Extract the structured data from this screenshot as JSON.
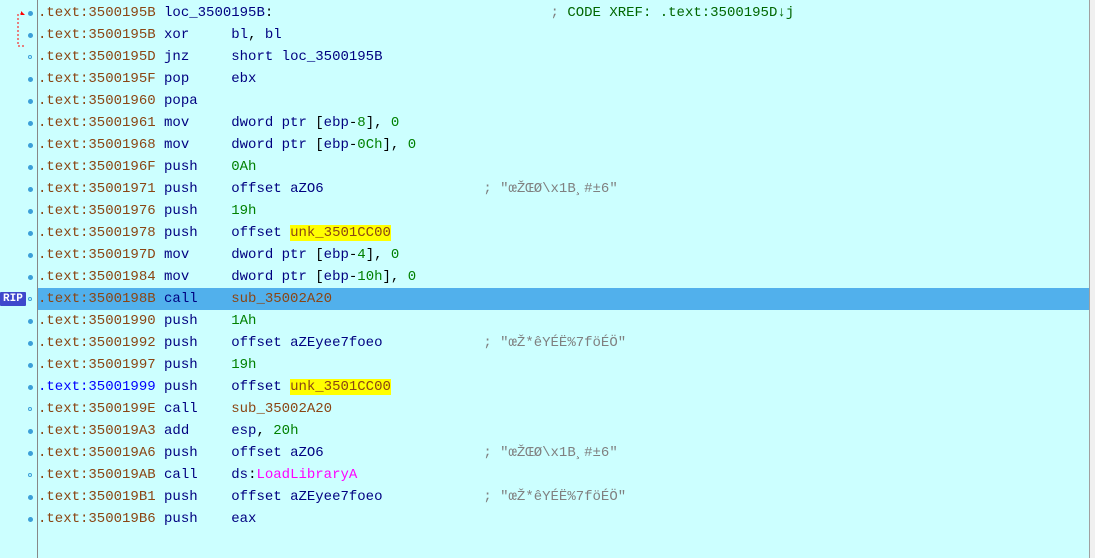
{
  "rip_label": "RIP",
  "lines": [
    {
      "addr_color": "brown",
      "addr": ".text:3500195B",
      "parts": [
        {
          "t": " ",
          "c": ""
        },
        {
          "t": "loc_3500195B",
          "c": "label"
        },
        {
          "t": ":",
          "c": ""
        },
        {
          "t": "                                 ",
          "c": ""
        },
        {
          "t": "; ",
          "c": "comment"
        },
        {
          "t": "CODE XREF: .text:3500195D↓j",
          "c": "xref-dark"
        }
      ],
      "dot": "solid"
    },
    {
      "addr_color": "brown",
      "addr": ".text:3500195B",
      "parts": [
        {
          "t": " ",
          "c": ""
        },
        {
          "t": "xor     ",
          "c": "mnemonic"
        },
        {
          "t": "bl",
          "c": "reg"
        },
        {
          "t": ", ",
          "c": ""
        },
        {
          "t": "bl",
          "c": "reg"
        }
      ],
      "dot": "solid"
    },
    {
      "addr_color": "brown",
      "addr": ".text:3500195D",
      "parts": [
        {
          "t": " ",
          "c": ""
        },
        {
          "t": "jnz     ",
          "c": "mnemonic"
        },
        {
          "t": "short ",
          "c": "keyword"
        },
        {
          "t": "loc_3500195B",
          "c": "operand"
        }
      ],
      "dot": "hollow"
    },
    {
      "addr_color": "brown",
      "addr": ".text:3500195F",
      "parts": [
        {
          "t": " ",
          "c": ""
        },
        {
          "t": "pop     ",
          "c": "mnemonic"
        },
        {
          "t": "ebx",
          "c": "reg"
        }
      ],
      "dot": "solid"
    },
    {
      "addr_color": "brown",
      "addr": ".text:35001960",
      "parts": [
        {
          "t": " ",
          "c": ""
        },
        {
          "t": "popa",
          "c": "mnemonic"
        }
      ],
      "dot": "solid"
    },
    {
      "addr_color": "brown",
      "addr": ".text:35001961",
      "parts": [
        {
          "t": " ",
          "c": ""
        },
        {
          "t": "mov     ",
          "c": "mnemonic"
        },
        {
          "t": "dword ptr ",
          "c": "keyword"
        },
        {
          "t": "[",
          "c": ""
        },
        {
          "t": "ebp",
          "c": "reg"
        },
        {
          "t": "-",
          "c": ""
        },
        {
          "t": "8",
          "c": "num-green"
        },
        {
          "t": "], ",
          "c": ""
        },
        {
          "t": "0",
          "c": "num-green"
        }
      ],
      "dot": "solid"
    },
    {
      "addr_color": "brown",
      "addr": ".text:35001968",
      "parts": [
        {
          "t": " ",
          "c": ""
        },
        {
          "t": "mov     ",
          "c": "mnemonic"
        },
        {
          "t": "dword ptr ",
          "c": "keyword"
        },
        {
          "t": "[",
          "c": ""
        },
        {
          "t": "ebp",
          "c": "reg"
        },
        {
          "t": "-",
          "c": ""
        },
        {
          "t": "0Ch",
          "c": "num-green"
        },
        {
          "t": "], ",
          "c": ""
        },
        {
          "t": "0",
          "c": "num-green"
        }
      ],
      "dot": "solid"
    },
    {
      "addr_color": "brown",
      "addr": ".text:3500196F",
      "parts": [
        {
          "t": " ",
          "c": ""
        },
        {
          "t": "push    ",
          "c": "mnemonic"
        },
        {
          "t": "0Ah",
          "c": "num-green"
        }
      ],
      "dot": "solid"
    },
    {
      "addr_color": "brown",
      "addr": ".text:35001971",
      "parts": [
        {
          "t": " ",
          "c": ""
        },
        {
          "t": "push    ",
          "c": "mnemonic"
        },
        {
          "t": "offset ",
          "c": "keyword"
        },
        {
          "t": "aZO6",
          "c": "operand"
        },
        {
          "t": "                   ",
          "c": ""
        },
        {
          "t": "; \"œŽŒØ\\x1B¸#±6\"",
          "c": "comment"
        }
      ],
      "dot": "solid"
    },
    {
      "addr_color": "brown",
      "addr": ".text:35001976",
      "parts": [
        {
          "t": " ",
          "c": ""
        },
        {
          "t": "push    ",
          "c": "mnemonic"
        },
        {
          "t": "19h",
          "c": "num-green"
        }
      ],
      "dot": "solid"
    },
    {
      "addr_color": "brown",
      "addr": ".text:35001978",
      "parts": [
        {
          "t": " ",
          "c": ""
        },
        {
          "t": "push    ",
          "c": "mnemonic"
        },
        {
          "t": "offset ",
          "c": "keyword"
        },
        {
          "t": "unk_3501CC00",
          "c": "hl-yellow"
        }
      ],
      "dot": "solid"
    },
    {
      "addr_color": "brown",
      "addr": ".text:3500197D",
      "parts": [
        {
          "t": " ",
          "c": ""
        },
        {
          "t": "mov     ",
          "c": "mnemonic"
        },
        {
          "t": "dword ptr ",
          "c": "keyword"
        },
        {
          "t": "[",
          "c": ""
        },
        {
          "t": "ebp",
          "c": "reg"
        },
        {
          "t": "-",
          "c": ""
        },
        {
          "t": "4",
          "c": "num-green"
        },
        {
          "t": "], ",
          "c": ""
        },
        {
          "t": "0",
          "c": "num-green"
        }
      ],
      "dot": "solid"
    },
    {
      "addr_color": "brown",
      "addr": ".text:35001984",
      "parts": [
        {
          "t": " ",
          "c": ""
        },
        {
          "t": "mov     ",
          "c": "mnemonic"
        },
        {
          "t": "dword ptr ",
          "c": "keyword"
        },
        {
          "t": "[",
          "c": ""
        },
        {
          "t": "ebp",
          "c": "reg"
        },
        {
          "t": "-",
          "c": ""
        },
        {
          "t": "10h",
          "c": "num-green"
        },
        {
          "t": "], ",
          "c": ""
        },
        {
          "t": "0",
          "c": "num-green"
        }
      ],
      "dot": "solid"
    },
    {
      "addr_color": "brown",
      "addr": ".text:3500198B",
      "parts": [
        {
          "t": " ",
          "c": ""
        },
        {
          "t": "call    ",
          "c": "mnemonic"
        },
        {
          "t": "sub_35002A20",
          "c": "sub-name"
        }
      ],
      "selected": true,
      "dot": "hollow",
      "rip": true
    },
    {
      "addr_color": "brown",
      "addr": ".text:35001990",
      "parts": [
        {
          "t": " ",
          "c": ""
        },
        {
          "t": "push    ",
          "c": "mnemonic"
        },
        {
          "t": "1Ah",
          "c": "num-green"
        }
      ],
      "dot": "solid"
    },
    {
      "addr_color": "brown",
      "addr": ".text:35001992",
      "parts": [
        {
          "t": " ",
          "c": ""
        },
        {
          "t": "push    ",
          "c": "mnemonic"
        },
        {
          "t": "offset ",
          "c": "keyword"
        },
        {
          "t": "aZEyee7foeo",
          "c": "operand"
        },
        {
          "t": "            ",
          "c": ""
        },
        {
          "t": "; \"œŽ*êYÉË%7föÉÖ\"",
          "c": "comment"
        }
      ],
      "dot": "solid"
    },
    {
      "addr_color": "brown",
      "addr": ".text:35001997",
      "parts": [
        {
          "t": " ",
          "c": ""
        },
        {
          "t": "push    ",
          "c": "mnemonic"
        },
        {
          "t": "19h",
          "c": "num-green"
        }
      ],
      "dot": "solid"
    },
    {
      "addr_color": "blue",
      "addr": ".text:35001999",
      "parts": [
        {
          "t": " ",
          "c": ""
        },
        {
          "t": "push    ",
          "c": "mnemonic"
        },
        {
          "t": "offset ",
          "c": "keyword"
        },
        {
          "t": "unk_3501CC",
          "c": "hl-yellow"
        },
        {
          "t": "00",
          "c": "hl-yellow"
        }
      ],
      "dot": "solid"
    },
    {
      "addr_color": "brown",
      "addr": ".text:3500199E",
      "parts": [
        {
          "t": " ",
          "c": ""
        },
        {
          "t": "call    ",
          "c": "mnemonic"
        },
        {
          "t": "sub_35002A20",
          "c": "sub-name"
        }
      ],
      "dot": "hollow"
    },
    {
      "addr_color": "brown",
      "addr": ".text:350019A3",
      "parts": [
        {
          "t": " ",
          "c": ""
        },
        {
          "t": "add     ",
          "c": "mnemonic"
        },
        {
          "t": "esp",
          "c": "reg"
        },
        {
          "t": ", ",
          "c": ""
        },
        {
          "t": "20h",
          "c": "num-green"
        }
      ],
      "dot": "solid"
    },
    {
      "addr_color": "brown",
      "addr": ".text:350019A6",
      "parts": [
        {
          "t": " ",
          "c": ""
        },
        {
          "t": "push    ",
          "c": "mnemonic"
        },
        {
          "t": "offset ",
          "c": "keyword"
        },
        {
          "t": "aZO6",
          "c": "operand"
        },
        {
          "t": "                   ",
          "c": ""
        },
        {
          "t": "; \"œŽŒØ\\x1B¸#±6\"",
          "c": "comment"
        }
      ],
      "dot": "solid"
    },
    {
      "addr_color": "brown",
      "addr": ".text:350019AB",
      "parts": [
        {
          "t": " ",
          "c": ""
        },
        {
          "t": "call    ",
          "c": "mnemonic"
        },
        {
          "t": "ds",
          "c": "reg"
        },
        {
          "t": ":",
          "c": ""
        },
        {
          "t": "LoadLibraryA",
          "c": "pink"
        }
      ],
      "dot": "hollow"
    },
    {
      "addr_color": "brown",
      "addr": ".text:350019B1",
      "parts": [
        {
          "t": " ",
          "c": ""
        },
        {
          "t": "push    ",
          "c": "mnemonic"
        },
        {
          "t": "offset ",
          "c": "keyword"
        },
        {
          "t": "aZEyee7foeo",
          "c": "operand"
        },
        {
          "t": "            ",
          "c": ""
        },
        {
          "t": "; \"œŽ*êYÉË%7föÉÖ\"",
          "c": "comment"
        }
      ],
      "dot": "solid"
    },
    {
      "addr_color": "brown",
      "addr": ".text:350019B6",
      "parts": [
        {
          "t": " ",
          "c": ""
        },
        {
          "t": "push    ",
          "c": "mnemonic"
        },
        {
          "t": "eax",
          "c": "reg"
        }
      ],
      "dot": "solid"
    }
  ]
}
